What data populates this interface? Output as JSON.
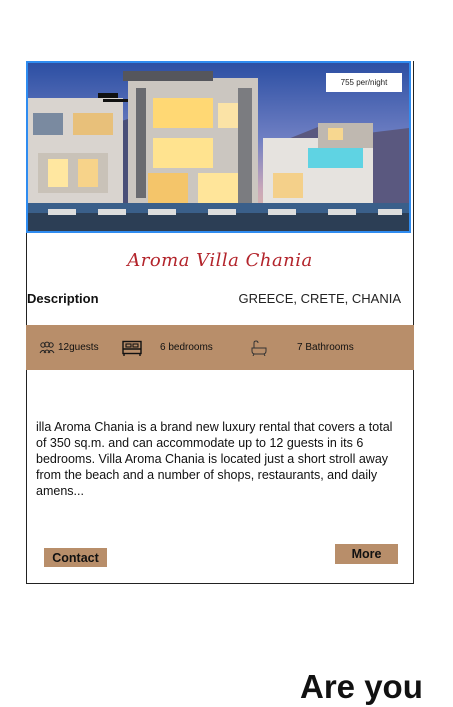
{
  "listing": {
    "price": "755 per/night",
    "title": "Aroma Villa Chania",
    "description_label": "Description",
    "location": "GREECE, CRETE, CHANIA",
    "amenities": {
      "guests": "12guests",
      "bedrooms": "6 bedrooms",
      "bathrooms": "7 Bathrooms"
    },
    "description": "illa Aroma Chania is a brand new luxury rental that covers a total of 350 sq.m. and can accommodate up to 12 guests in its 6 bedrooms. Villa Aroma Chania is located just a short stroll away from the beach and a number of shops, restaurants, and daily amens...",
    "contact_label": "Contact",
    "more_label": "More"
  },
  "footer": {
    "headline": "Are you"
  },
  "colors": {
    "accent": "#b88e6a",
    "title": "#b3242b",
    "selection": "#2f8cf0"
  }
}
